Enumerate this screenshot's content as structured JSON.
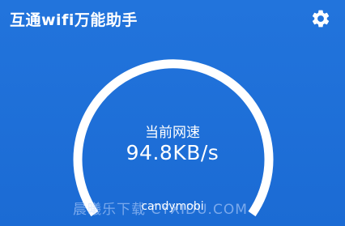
{
  "header": {
    "title": "互通wifi万能助手",
    "settings_icon": "gear-icon"
  },
  "speed": {
    "label": "当前网速",
    "value": "94.8KB/s"
  },
  "user": {
    "name": "candymobi"
  },
  "watermark": {
    "text": "晨曦乐下载 CYXIDU.COM"
  },
  "colors": {
    "background": "#1e6fd9",
    "foreground": "#ffffff"
  }
}
